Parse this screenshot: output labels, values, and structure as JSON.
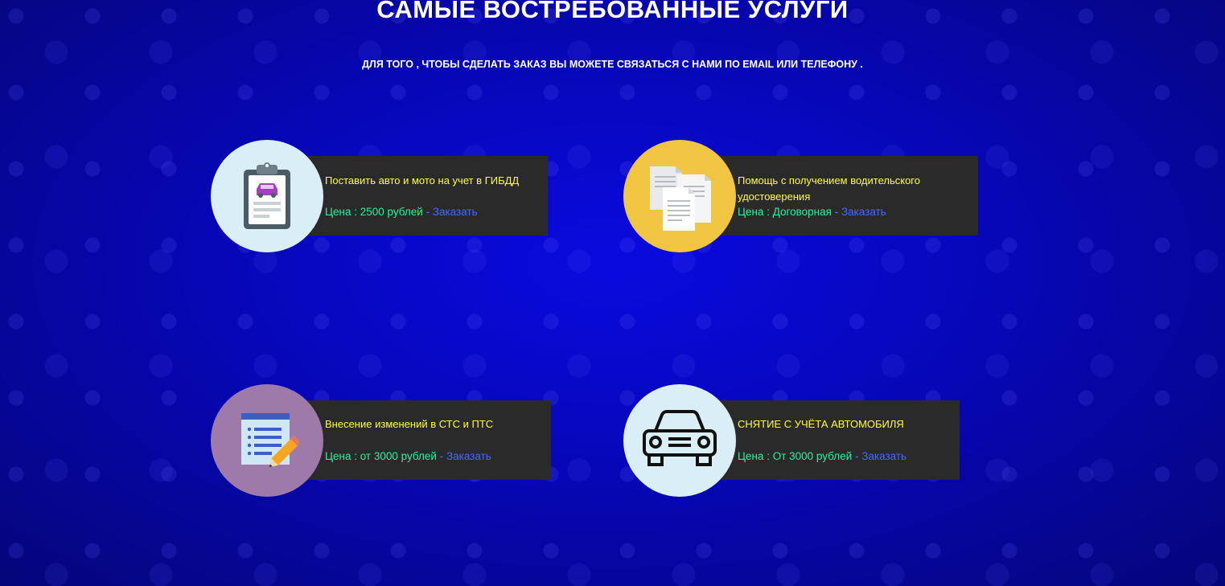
{
  "header": {
    "title": "САМЫЕ ВОСТРЕБОВАННЫЕ УСЛУГИ",
    "subtitle": "ДЛЯ ТОГО , ЧТОБЫ СДЕЛАТЬ ЗАКАЗ ВЫ МОЖЕТЕ СВЯЗАТЬСЯ С НАМИ ПО EMAIL ИЛИ ТЕЛЕФОНУ ."
  },
  "services": [
    {
      "title": "Поставить авто и мото на учет в ГИБДД",
      "price": "Цена : 2500 рублей",
      "separator": " - ",
      "order": "Заказать",
      "icon": "clipboard-car-icon",
      "circle_color": "#d9eef5"
    },
    {
      "title": "Помощь с получением водительского удостоверения",
      "price": "Цена : Договорная",
      "separator": " - ",
      "order": "Заказать",
      "icon": "documents-icon",
      "circle_color": "#efc541"
    },
    {
      "title": "Внесение изменений в СТС и ПТС",
      "price": "Цена : от 3000 рублей",
      "separator": " - ",
      "order": "Заказать",
      "icon": "notepad-pencil-icon",
      "circle_color": "#9e7aab"
    },
    {
      "title": "СНЯТИЕ С УЧЁТА АВТОМОБИЛЯ",
      "price": "Цена : От 3000 рублей",
      "separator": " - ",
      "order": "Заказать",
      "icon": "car-icon",
      "circle_color": "#d9eef5"
    }
  ]
}
